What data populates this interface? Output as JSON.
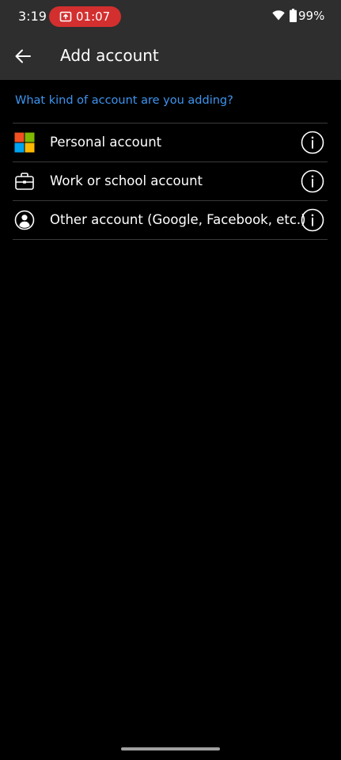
{
  "status_bar": {
    "time": "3:19",
    "recording_timer": "01:07",
    "battery_percent": "99%",
    "recording_color": "#d32f2f"
  },
  "app_bar": {
    "title": "Add account",
    "back_icon": "arrow-left-icon"
  },
  "prompt": "What kind of account are you adding?",
  "accent_color": "#3d95f0",
  "accounts": [
    {
      "label": "Personal account",
      "icon": "microsoft-logo-icon"
    },
    {
      "label": "Work or school account",
      "icon": "briefcase-icon"
    },
    {
      "label": "Other account (Google, Facebook, etc.)",
      "icon": "person-circle-icon"
    }
  ],
  "info_icon": "info-icon"
}
